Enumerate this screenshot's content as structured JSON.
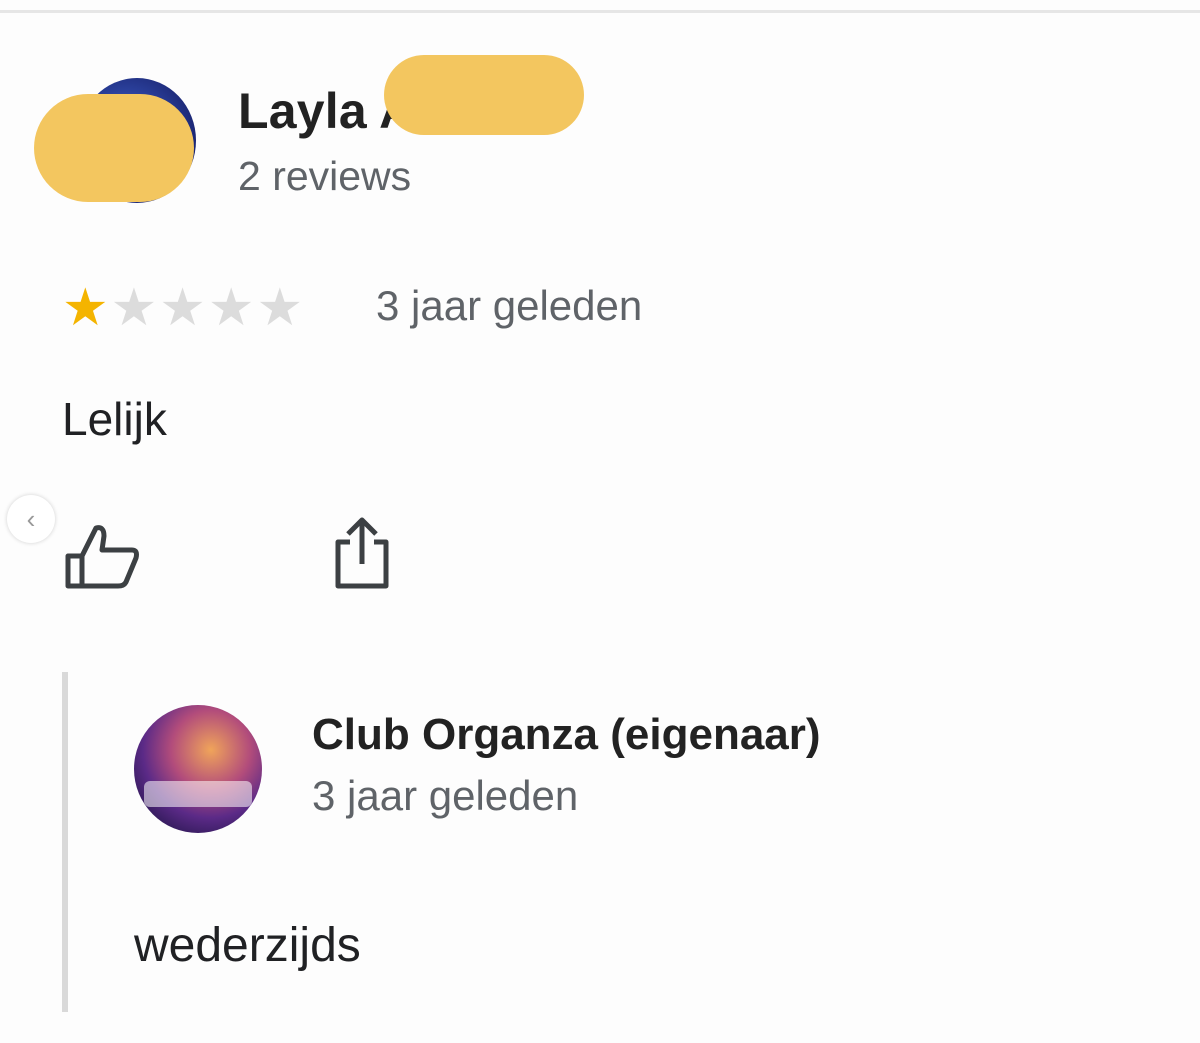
{
  "review": {
    "author_name": "Layla A",
    "review_count": "2 reviews",
    "rating": 1,
    "rating_max": 5,
    "time": "3 jaar geleden",
    "text": "Lelijk"
  },
  "actions": {
    "like_icon": "thumbs-up-icon",
    "share_icon": "share-icon"
  },
  "pager": {
    "icon": "chevron-left-icon",
    "glyph": "‹"
  },
  "owner_reply": {
    "author": "Club Organza (eigenaar)",
    "time": "3 jaar geleden",
    "text": "wederzijds"
  },
  "colors": {
    "star_filled": "#f4b400",
    "star_empty": "#dcdcdc",
    "redaction": "#f3c65f",
    "secondary_text": "#5f6368"
  }
}
